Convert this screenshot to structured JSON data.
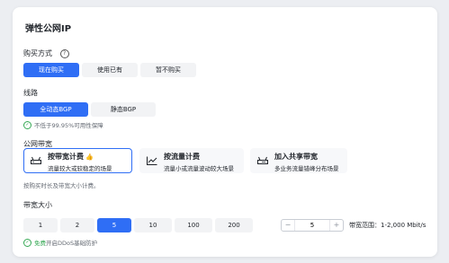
{
  "title": "弹性公网IP",
  "purchase": {
    "label": "购买方式",
    "help_icon": "?",
    "options": [
      "现在购买",
      "使用已有",
      "暂不购买"
    ],
    "selected": "现在购买"
  },
  "line": {
    "label": "线路",
    "options": [
      "全动态BGP",
      "静态BGP"
    ],
    "selected": "全动态BGP",
    "note": "不低于99.95%可用性保障"
  },
  "bandwidth": {
    "label": "公网带宽",
    "options": [
      {
        "name": "按带宽计费",
        "desc": "流量较大或较稳定的场景",
        "recommended_icon": "👍",
        "icon": "bandwidth-router-icon"
      },
      {
        "name": "按流量计费",
        "desc": "流量小或流量波动较大场景",
        "icon": "traffic-chart-icon"
      },
      {
        "name": "加入共享带宽",
        "desc": "多业务流量错峰分布场景",
        "icon": "shared-bandwidth-icon"
      }
    ],
    "selected": "按带宽计费",
    "note": "按购买时长及带宽大小计费。"
  },
  "size": {
    "label": "带宽大小",
    "options": [
      "1",
      "2",
      "5",
      "10",
      "100",
      "200"
    ],
    "selected": "5",
    "stepper_value": "5",
    "minus": "−",
    "plus": "+",
    "range": "带宽范围：1-2,000 Mbit/s",
    "ddos_free": "免费",
    "ddos_text": "开启DDoS基础防护"
  },
  "colors": {
    "accent": "#2f6ef5",
    "success": "#34a853",
    "page_bg": "#eceef2"
  }
}
